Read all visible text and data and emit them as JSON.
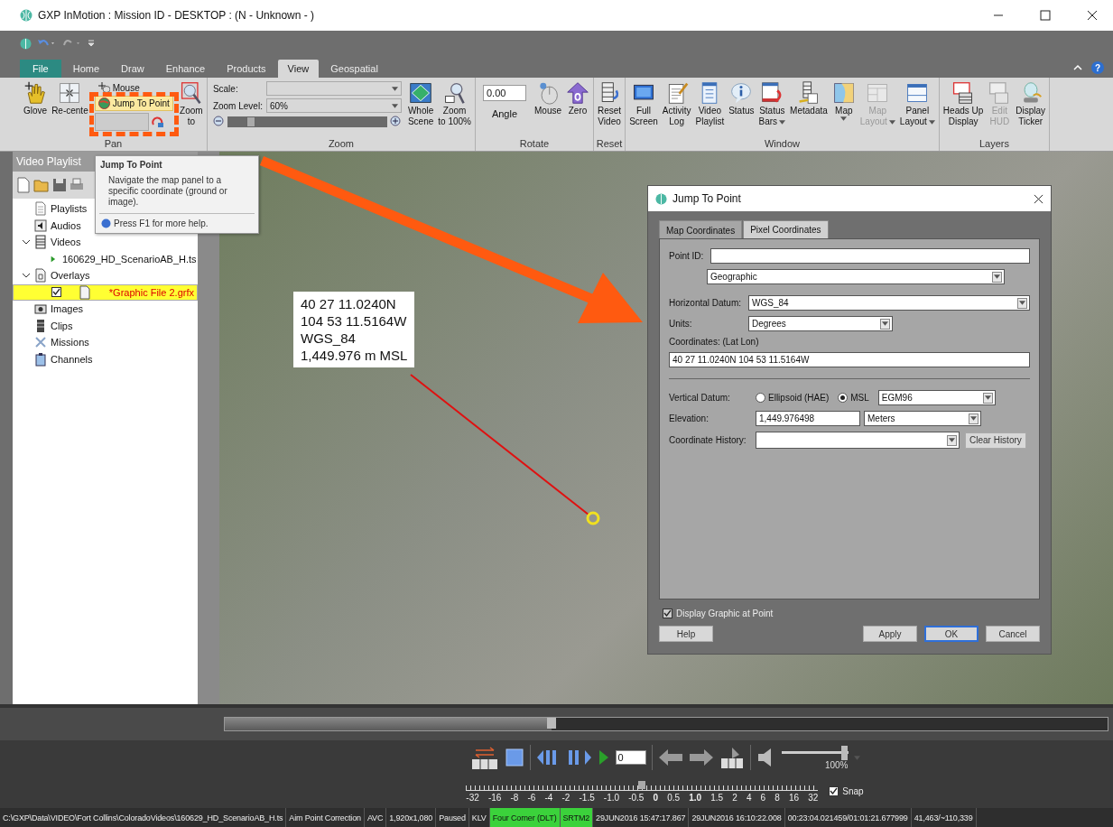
{
  "window": {
    "title": "GXP InMotion : Mission ID - DESKTOP : (N - Unknown - )"
  },
  "ribbon_tabs": [
    {
      "label": "File",
      "selected": false,
      "kind": "file"
    },
    {
      "label": "Home",
      "selected": false,
      "kind": "tab"
    },
    {
      "label": "Draw",
      "selected": false,
      "kind": "tab"
    },
    {
      "label": "Enhance",
      "selected": false,
      "kind": "tab"
    },
    {
      "label": "Products",
      "selected": false,
      "kind": "tab"
    },
    {
      "label": "View",
      "selected": true,
      "kind": "tab"
    },
    {
      "label": "Geospatial",
      "selected": false,
      "kind": "tab"
    }
  ],
  "help_button": "?",
  "ribbon_groups": [
    {
      "label": "Pan",
      "items": [
        {
          "kind": "large",
          "lines": [
            "Glove"
          ],
          "disabled": false
        },
        {
          "kind": "large",
          "lines": [
            "Re-cente"
          ],
          "disabled": false
        },
        {
          "kind": "stack",
          "entries": [
            {
              "label": "Mouse",
              "highlighted": false
            },
            {
              "label": "Jump To Point",
              "highlighted": true
            }
          ]
        },
        {
          "kind": "large",
          "lines": [
            "Zoom",
            "to"
          ],
          "disabled": false
        }
      ]
    },
    {
      "label": "Zoom",
      "items": [
        {
          "kind": "zoom",
          "scale_label": "Scale:",
          "zoom_label": "Zoom Level:",
          "zoom_value": "60%",
          "level": 0.12
        },
        {
          "kind": "large",
          "lines": [
            "Whole",
            "Scene"
          ],
          "disabled": false
        },
        {
          "kind": "large",
          "lines": [
            "Zoom",
            "to 100%"
          ],
          "disabled": false
        }
      ]
    },
    {
      "label": "Rotate",
      "items": [
        {
          "kind": "angle",
          "value": "0.00",
          "label": "Angle"
        },
        {
          "kind": "large",
          "lines": [
            "Mouse"
          ],
          "disabled": false
        },
        {
          "kind": "large",
          "lines": [
            "Zero"
          ],
          "disabled": false
        }
      ]
    },
    {
      "label": "Reset",
      "items": [
        {
          "kind": "large",
          "lines": [
            "Reset",
            "Video"
          ],
          "disabled": false
        }
      ]
    },
    {
      "label": "Window",
      "items": [
        {
          "kind": "large",
          "lines": [
            "Full",
            "Screen"
          ],
          "disabled": false
        },
        {
          "kind": "large",
          "lines": [
            "Activity",
            "Log"
          ],
          "disabled": false
        },
        {
          "kind": "large",
          "lines": [
            "Video",
            "Playlist"
          ],
          "disabled": false
        },
        {
          "kind": "large",
          "lines": [
            "Status"
          ],
          "disabled": false
        },
        {
          "kind": "large",
          "lines": [
            "Status",
            "Bars"
          ],
          "dropdown": true,
          "disabled": false
        },
        {
          "kind": "large",
          "lines": [
            "Metadata"
          ],
          "disabled": false
        },
        {
          "kind": "large",
          "lines": [
            "Map"
          ],
          "dropdown": true,
          "disabled": false
        },
        {
          "kind": "large",
          "lines": [
            "Map",
            "Layout"
          ],
          "dropdown": true,
          "disabled": true
        },
        {
          "kind": "large",
          "lines": [
            "Panel",
            "Layout"
          ],
          "dropdown": true,
          "disabled": false
        }
      ]
    },
    {
      "label": "Layers",
      "items": [
        {
          "kind": "large",
          "lines": [
            "Heads Up",
            "Display"
          ],
          "disabled": false
        },
        {
          "kind": "large",
          "lines": [
            "Edit",
            "HUD"
          ],
          "disabled": true
        },
        {
          "kind": "large",
          "lines": [
            "Display",
            "Ticker"
          ],
          "disabled": false
        }
      ]
    }
  ],
  "tooltip": {
    "title": "Jump To Point",
    "body": "Navigate the map panel to a specific coordinate (ground or image).",
    "help": "Press F1 for more help."
  },
  "playlist_panel": {
    "title": "Video Playlist",
    "tree": [
      {
        "label": "Playlists",
        "selected": false
      },
      {
        "label": "Audios",
        "selected": false
      },
      {
        "label": "Videos",
        "selected": false,
        "expanded": true,
        "children": [
          {
            "label": "160629_HD_ScenarioAB_H.ts",
            "kind": "video",
            "selected": false
          }
        ]
      },
      {
        "label": "Overlays",
        "selected": false,
        "expanded": true,
        "children": [
          {
            "label": "*Graphic File 2.grfx",
            "kind": "overlay",
            "selected": true,
            "checked": true
          }
        ]
      },
      {
        "label": "Images",
        "selected": false
      },
      {
        "label": "Clips",
        "selected": false
      },
      {
        "label": "Missions",
        "selected": false
      },
      {
        "label": "Channels",
        "selected": false
      }
    ]
  },
  "video": {
    "callout": [
      "40 27 11.0240N",
      "104 53 11.5164W",
      "WGS_84",
      "1,449.976 m MSL"
    ]
  },
  "dialog": {
    "title": "Jump To Point",
    "tabs": [
      {
        "label": "Map Coordinates",
        "selected": true
      },
      {
        "label": "Pixel Coordinates",
        "selected": false
      }
    ],
    "point_id_label": "Point ID:",
    "coordinate_system": "Geographic",
    "horizontal_datum": {
      "label": "Horizontal Datum:",
      "value": "WGS_84"
    },
    "units": {
      "label": "Units:",
      "value": "Degrees"
    },
    "coordinates": {
      "label": "Coordinates: (Lat Lon)",
      "value": "40 27 11.0240N 104 53 11.5164W"
    },
    "vertical_datum": {
      "label": "Vertical Datum:",
      "options": [
        {
          "label": "Ellipsoid (HAE)",
          "selected": false
        },
        {
          "label": "MSL",
          "selected": true
        }
      ],
      "model": "EGM96"
    },
    "elevation": {
      "label": "Elevation:",
      "value": "1,449.976498",
      "unit": "Meters"
    },
    "coordinate_history": {
      "label": "Coordinate History:",
      "button": "Clear History"
    },
    "display_graphic": {
      "label": "Display Graphic at Point",
      "checked": true
    },
    "buttons": [
      {
        "label": "Help",
        "default": false
      },
      {
        "label": "Apply",
        "default": false
      },
      {
        "label": "OK",
        "default": true
      },
      {
        "label": "Cancel",
        "default": false
      }
    ]
  },
  "player": {
    "seek": {
      "level": 0.37
    },
    "frame": "0",
    "volume": {
      "level": 0.95,
      "reading": "100%"
    },
    "speed": {
      "level": 0.5,
      "ticks": [
        {
          "label": "-32",
          "bold": false
        },
        {
          "label": "-16",
          "bold": false
        },
        {
          "label": "-8",
          "bold": false
        },
        {
          "label": "-6",
          "bold": false
        },
        {
          "label": "-4",
          "bold": false
        },
        {
          "label": "-2",
          "bold": false
        },
        {
          "label": "-1.5",
          "bold": false
        },
        {
          "label": "-1.0",
          "bold": false
        },
        {
          "label": "-0.5",
          "bold": false
        },
        {
          "label": "0",
          "bold": true
        },
        {
          "label": "0.5",
          "bold": false
        },
        {
          "label": "1.0",
          "bold": true
        },
        {
          "label": "1.5",
          "bold": false
        },
        {
          "label": "2",
          "bold": false
        },
        {
          "label": "4",
          "bold": false
        },
        {
          "label": "6",
          "bold": false
        },
        {
          "label": "8",
          "bold": false
        },
        {
          "label": "16",
          "bold": false
        },
        {
          "label": "32",
          "bold": false
        }
      ]
    },
    "snap": {
      "label": "Snap",
      "checked": true
    }
  },
  "status_bar": [
    {
      "text": "C:\\GXP\\Data\\VIDEO\\Fort Collins\\ColoradoVideos\\160629_HD_ScenarioAB_H.ts",
      "highlighted": false
    },
    {
      "text": "Aim Point Correction",
      "highlighted": false
    },
    {
      "text": "AVC",
      "highlighted": false
    },
    {
      "text": "1,920x1,080",
      "highlighted": false
    },
    {
      "text": "Paused",
      "highlighted": false
    },
    {
      "text": "KLV",
      "highlighted": false
    },
    {
      "text": "Four Corner (DLT)",
      "highlighted": true
    },
    {
      "text": "SRTM2",
      "highlighted": true
    },
    {
      "text": "29JUN2016 15:47:17.867",
      "highlighted": false
    },
    {
      "text": "29JUN2016 16:10:22.008",
      "highlighted": false
    },
    {
      "text": "00:23:04.021459/01:01:21.677999",
      "highlighted": false
    },
    {
      "text": "41,463/~110,339",
      "highlighted": false
    }
  ]
}
